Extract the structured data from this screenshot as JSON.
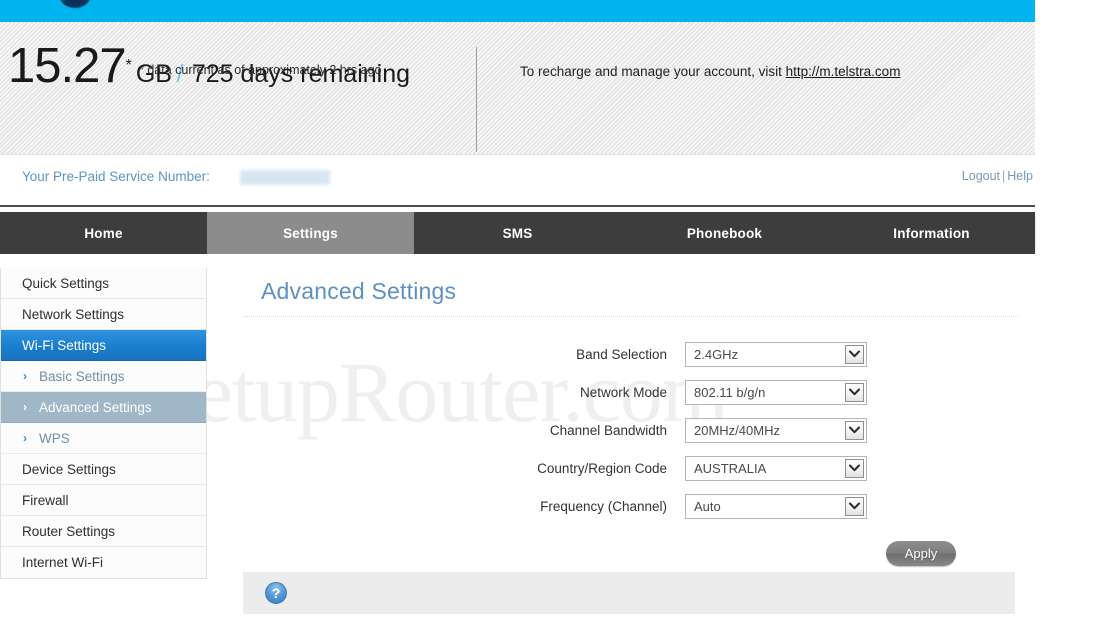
{
  "brand": {
    "bar_color": "#00b5ef",
    "logo_icon": "telstra-logo-icon"
  },
  "usage": {
    "amount": "15.27",
    "star": "*",
    "unit": "GB",
    "slash": "/",
    "remaining": "725 days remaining",
    "note": "* data current as of approximately 2 hrs ago"
  },
  "recharge": {
    "text": "To recharge and manage your account, visit ",
    "link": "http://m.telstra.com"
  },
  "account": {
    "service_label": "Your Pre-Paid Service Number:",
    "logout": "Logout",
    "separator": "|",
    "help": "Help"
  },
  "nav": {
    "tabs": [
      {
        "label": "Home",
        "active": false
      },
      {
        "label": "Settings",
        "active": true
      },
      {
        "label": "SMS",
        "active": false
      },
      {
        "label": "Phonebook",
        "active": false
      },
      {
        "label": "Information",
        "active": false
      }
    ]
  },
  "sidebar": {
    "items": [
      {
        "label": "Quick Settings",
        "type": "item",
        "selected": false
      },
      {
        "label": "Network Settings",
        "type": "item",
        "selected": false
      },
      {
        "label": "Wi-Fi Settings",
        "type": "item",
        "selected": true
      },
      {
        "label": "Basic Settings",
        "type": "sub",
        "selected": false
      },
      {
        "label": "Advanced Settings",
        "type": "sub",
        "selected": true
      },
      {
        "label": "WPS",
        "type": "sub",
        "selected": false
      },
      {
        "label": "Device Settings",
        "type": "item",
        "selected": false
      },
      {
        "label": "Firewall",
        "type": "item",
        "selected": false
      },
      {
        "label": "Router Settings",
        "type": "item",
        "selected": false
      },
      {
        "label": "Internet Wi-Fi",
        "type": "item",
        "selected": false
      }
    ],
    "chevron": "›"
  },
  "main": {
    "title": "Advanced Settings",
    "fields": [
      {
        "label": "Band Selection",
        "value": "2.4GHz"
      },
      {
        "label": "Network Mode",
        "value": "802.11 b/g/n"
      },
      {
        "label": "Channel Bandwidth",
        "value": "20MHz/40MHz"
      },
      {
        "label": "Country/Region Code",
        "value": "AUSTRALIA"
      },
      {
        "label": "Frequency (Channel)",
        "value": "Auto"
      }
    ],
    "apply_label": "Apply",
    "help_icon_label": "?"
  },
  "watermark": {
    "text": "SetupRouter.com"
  },
  "colors": {
    "brand_cyan": "#00b5ef",
    "nav_dark": "#3d3d3d",
    "nav_active": "#8c8c8c",
    "sidebar_selected": "#1c7fd0",
    "sidebar_sub_selected": "#9fb7c6",
    "title_blue": "#5d90c3",
    "link_blue": "#5b96c4"
  }
}
